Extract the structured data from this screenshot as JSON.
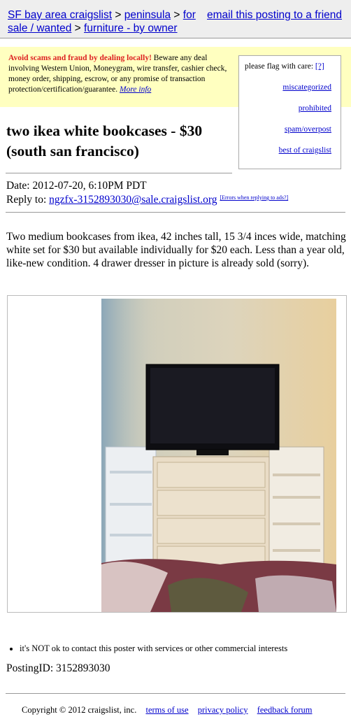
{
  "breadcrumb": {
    "site": "SF bay area craigslist",
    "sep1": ">",
    "area": "peninsula",
    "sep2": ">",
    "category_part1": "for",
    "category_part2": "sale / wanted",
    "sep3": ">",
    "subcategory": "furniture - by owner",
    "email_link": "email this posting to a friend"
  },
  "warning": {
    "bold": "Avoid scams and fraud by dealing locally!",
    "text": " Beware any deal involving Western Union, Moneygram, wire transfer, cashier check, money order, shipping, escrow, or any promise of transaction protection/certification/guarantee. ",
    "more_info": "More info"
  },
  "flag_box": {
    "title": "please flag with care:",
    "help": "[?]",
    "items": [
      "miscategorized",
      "prohibited",
      "spam/overpost",
      "best of craigslist"
    ]
  },
  "posting": {
    "title": "two ikea white bookcases - $30 (south san francisco)",
    "date": "Date: 2012-07-20, 6:10PM PDT",
    "reply_label": "Reply to: ",
    "reply_email": "ngzfx-3152893030@sale.craigslist.org",
    "errors_link": "[Errors when replying to ads?]",
    "body": "Two medium bookcases from ikea, 42 inches tall, 15 3/4 inces wide, matching white set for $30 but available individually for $20 each. Less than a year old, like-new condition. 4 drawer dresser in picture is already sold (sorry).",
    "image_alt": "photo of two white bookcases beside a dresser with a TV",
    "notice": "it's NOT ok to contact this poster with services or other commercial interests",
    "posting_id": "PostingID: 3152893030"
  },
  "footer": {
    "copyright": "Copyright © 2012 craigslist, inc.",
    "links": [
      "terms of use",
      "privacy policy",
      "feedback forum"
    ]
  }
}
